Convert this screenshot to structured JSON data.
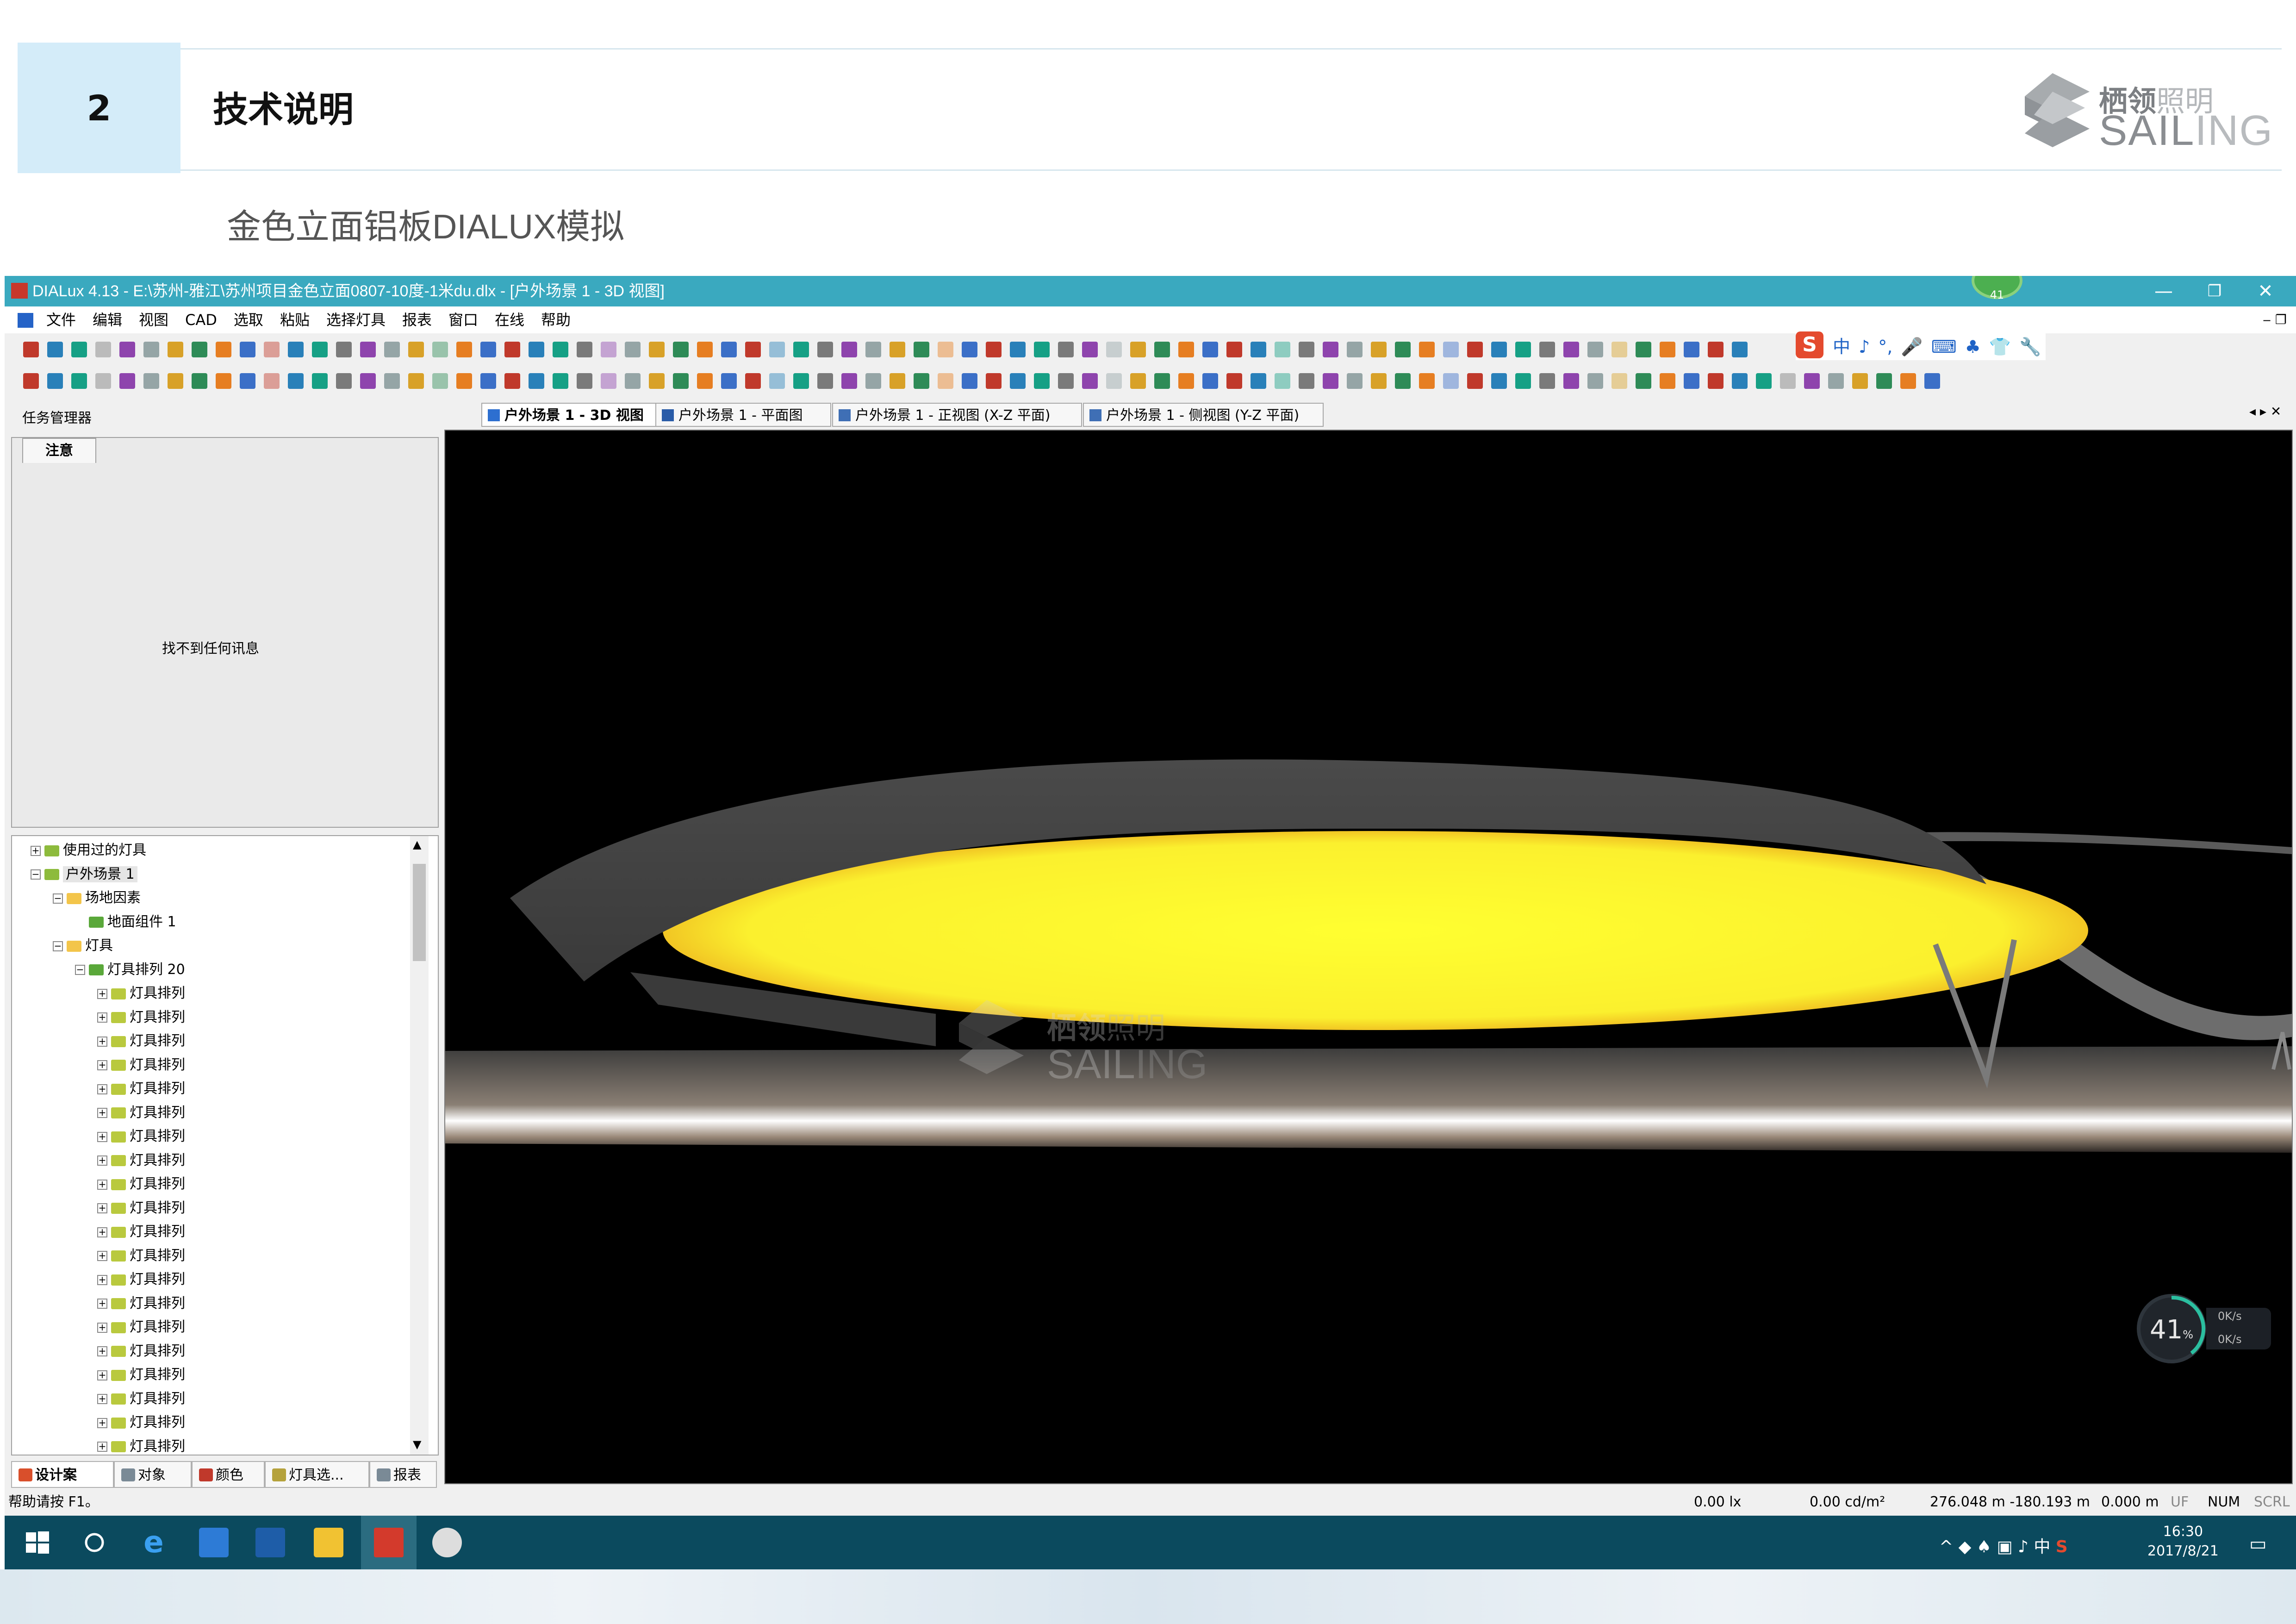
{
  "slide": {
    "section_number": "2",
    "section_title": "技术说明",
    "subtitle": "金色立面铝板DIALUX模拟",
    "logo_cn_bold": "栖领",
    "logo_cn_light": "照明",
    "logo_en_bold": "SAIL",
    "logo_en_light": "ING"
  },
  "window": {
    "title": "DIALux 4.13 - E:\\苏州-雅江\\苏州项目金色立面0807-10度-1米du.dlx - [户外场景 1 - 3D 视图]",
    "badge": "41",
    "minimize": "—",
    "restore": "❐",
    "close": "✕"
  },
  "menu": [
    "文件",
    "编辑",
    "视图",
    "CAD",
    "选取",
    "粘贴",
    "选择灯具",
    "报表",
    "窗口",
    "在线",
    "帮助"
  ],
  "ime": {
    "logo": "S",
    "items": [
      "中",
      "♪",
      "°,",
      "🎤",
      "⌨",
      "♣",
      "👕",
      "🔧"
    ]
  },
  "task_manager": {
    "label": "任务管理器",
    "tab": "注意",
    "message": "找不到任何讯息"
  },
  "tree": {
    "rows": [
      {
        "label": "使用过的灯具",
        "level": 1
      },
      {
        "label": "户外场景 1",
        "level": 1
      },
      {
        "label": "场地因素",
        "level": 2
      },
      {
        "label": "地面组件 1",
        "level": 3
      },
      {
        "label": "灯具",
        "level": 2
      },
      {
        "label": "灯具排列 20",
        "level": 3
      },
      {
        "label": "灯具排列",
        "level": 4
      },
      {
        "label": "灯具排列",
        "level": 4
      },
      {
        "label": "灯具排列",
        "level": 4
      },
      {
        "label": "灯具排列",
        "level": 4
      },
      {
        "label": "灯具排列",
        "level": 4
      },
      {
        "label": "灯具排列",
        "level": 4
      },
      {
        "label": "灯具排列",
        "level": 4
      },
      {
        "label": "灯具排列",
        "level": 4
      },
      {
        "label": "灯具排列",
        "level": 4
      },
      {
        "label": "灯具排列",
        "level": 4
      },
      {
        "label": "灯具排列",
        "level": 4
      },
      {
        "label": "灯具排列",
        "level": 4
      },
      {
        "label": "灯具排列",
        "level": 4
      },
      {
        "label": "灯具排列",
        "level": 4
      },
      {
        "label": "灯具排列",
        "level": 4
      },
      {
        "label": "灯具排列",
        "level": 4
      },
      {
        "label": "灯具排列",
        "level": 4
      },
      {
        "label": "灯具排列",
        "level": 4
      },
      {
        "label": "灯具排列",
        "level": 4
      },
      {
        "label": "灯具排列",
        "level": 4
      }
    ]
  },
  "bottom_tabs": [
    "设计案",
    "对象",
    "颜色",
    "灯具选...",
    "报表"
  ],
  "view_tabs": [
    "户外场景 1 - 3D 视图",
    "户外场景 1 - 平面图",
    "户外场景 1 - 正视图 (X-Z 平面)",
    "户外场景 1 - 侧视图 (Y-Z 平面)"
  ],
  "viewport": {
    "watermark_cn_bold": "栖领",
    "watermark_cn_light": "照明",
    "watermark_en_bold": "SAIL",
    "watermark_en_light": "ING",
    "speed_percent": "41",
    "speed_unit": "%",
    "up_rate": "0K/s",
    "down_rate": "0K/s"
  },
  "statusbar": {
    "help": "帮助请按 F1。",
    "lux": "0.00 lx",
    "luminance": "0.00 cd/m²",
    "coords": "276.048 m  -180.193 m",
    "height": "0.000 m",
    "uf": "UF",
    "num": "NUM",
    "scrl": "SCRL"
  },
  "taskbar": {
    "time": "16:30",
    "date": "2017/8/21",
    "ime_cn": "中"
  }
}
